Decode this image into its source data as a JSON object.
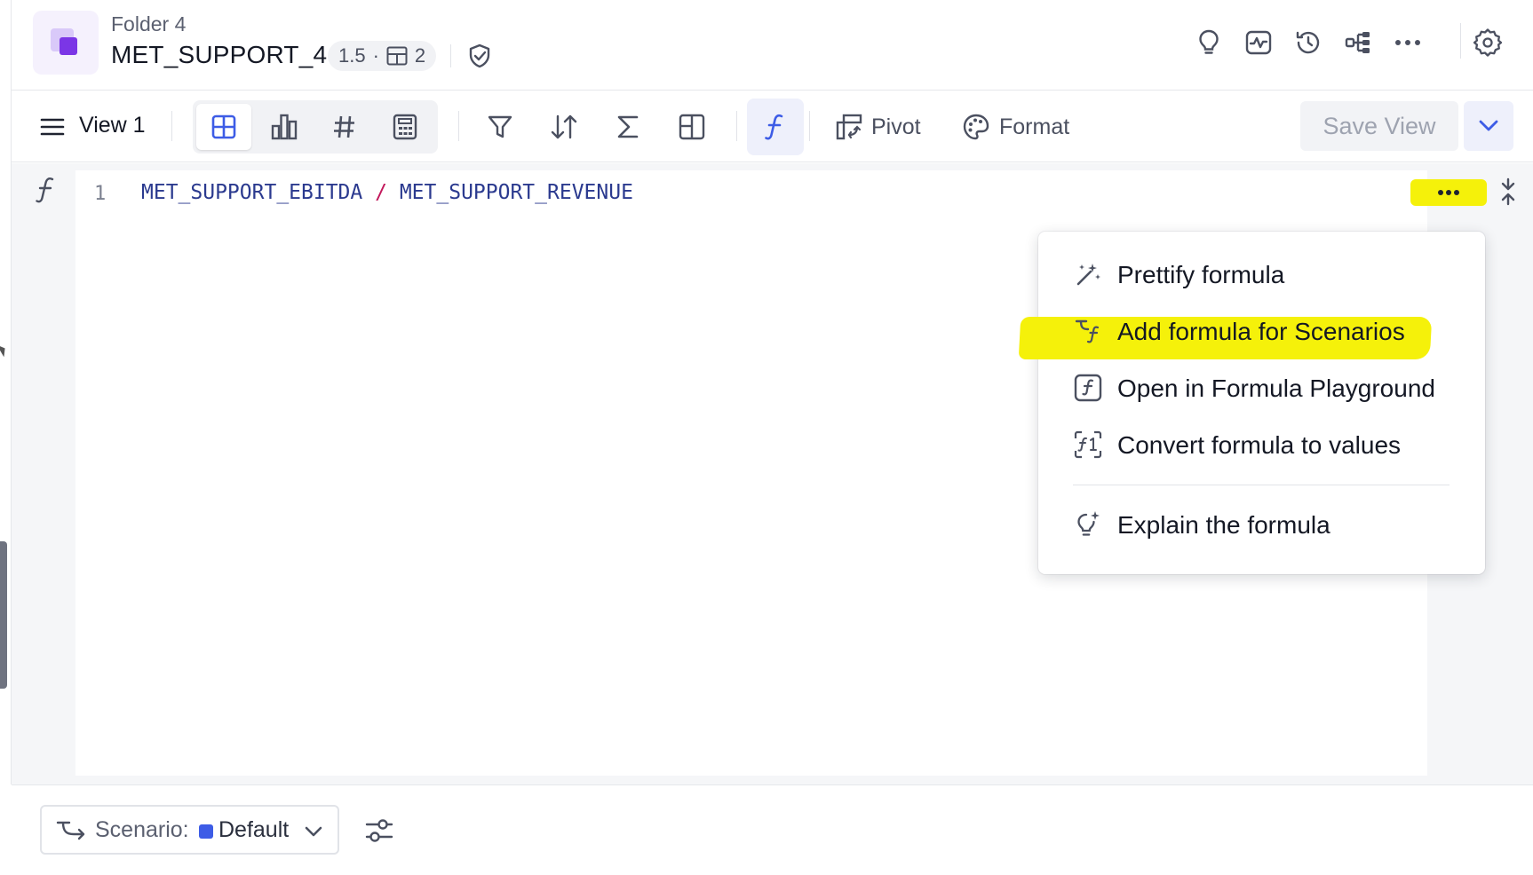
{
  "header": {
    "folder": "Folder 4",
    "title": "MET_SUPPORT_4",
    "version": "1.5",
    "separator": "·",
    "sheet_count": "2"
  },
  "toolbar": {
    "view_label": "View 1",
    "pivot_label": "Pivot",
    "format_label": "Format",
    "save_view_label": "Save View"
  },
  "editor": {
    "line_number": "1",
    "formula_left": "MET_SUPPORT_EBITDA",
    "formula_op": "/",
    "formula_right": "MET_SUPPORT_REVENUE"
  },
  "menu": {
    "items": [
      {
        "label": "Prettify formula",
        "icon": "magic-wand-icon"
      },
      {
        "label": "Add formula for Scenarios",
        "icon": "scenario-formula-icon"
      },
      {
        "label": "Open in Formula Playground",
        "icon": "formula-playground-icon"
      },
      {
        "label": "Convert formula to values",
        "icon": "convert-values-icon"
      },
      {
        "label": "Explain the formula",
        "icon": "lightbulb-sparkle-icon"
      }
    ]
  },
  "footer": {
    "scenario_label": "Scenario:",
    "scenario_value": "Default"
  },
  "colors": {
    "accent": "#3d5ce6",
    "highlight": "#f5f10a",
    "brand": "#7b36e6"
  }
}
